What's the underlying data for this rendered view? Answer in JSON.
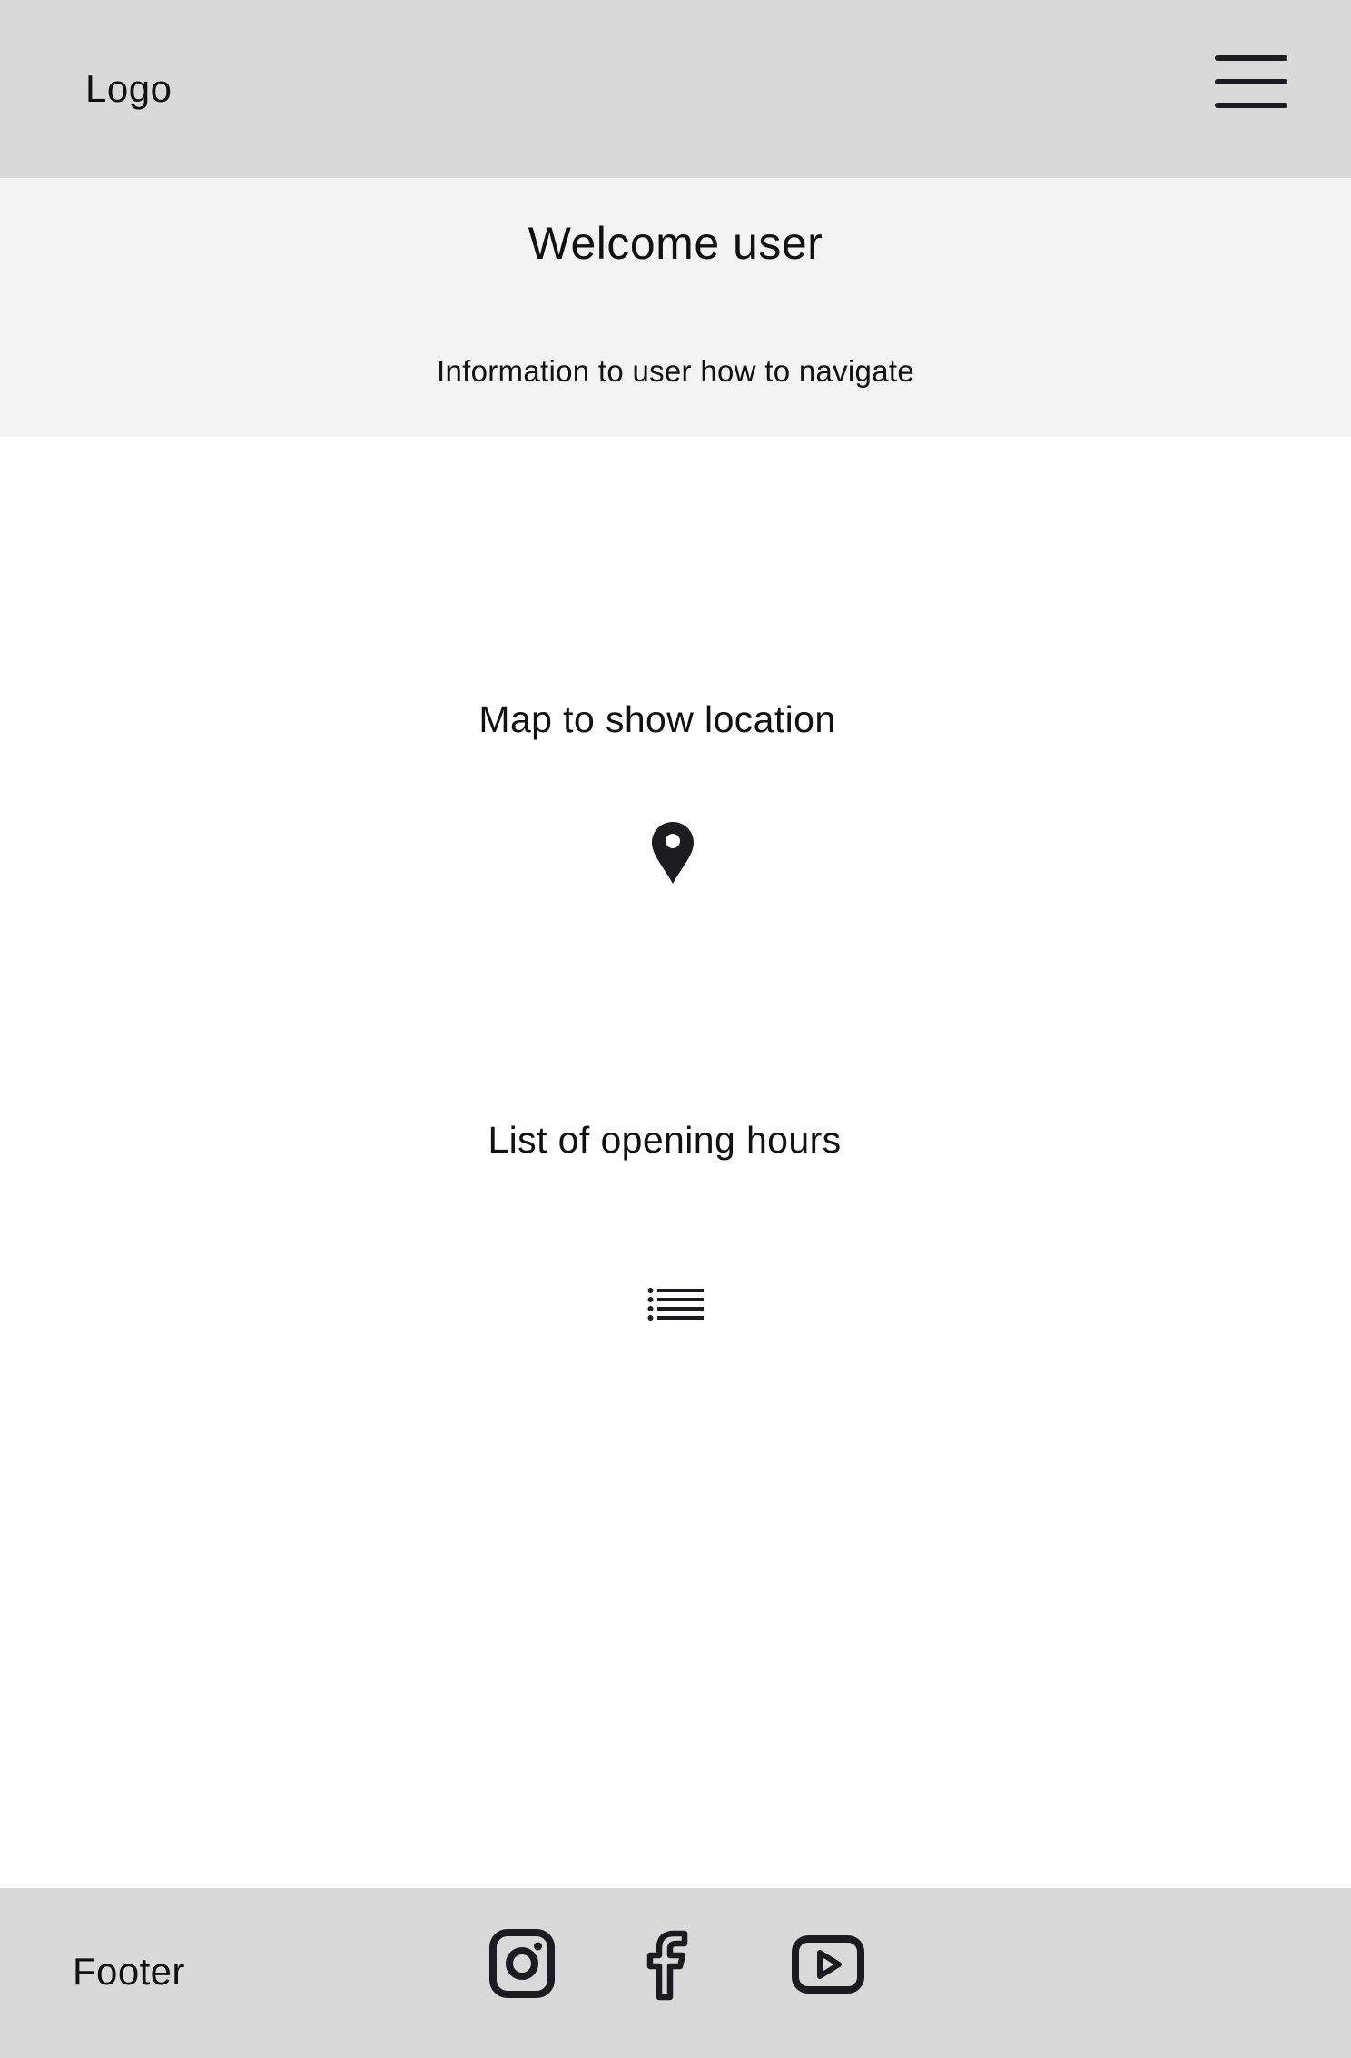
{
  "header": {
    "logo_text": "Logo",
    "menu_icon": "hamburger-menu-icon"
  },
  "welcome": {
    "title": "Welcome user",
    "info": "Information to user how to navigate"
  },
  "main": {
    "map": {
      "label": "Map to show location",
      "icon": "map-pin-icon"
    },
    "opening_hours": {
      "label": "List of opening hours",
      "icon": "list-icon"
    }
  },
  "footer": {
    "label": "Footer",
    "social": [
      {
        "name": "Instagram",
        "icon": "instagram-icon"
      },
      {
        "name": "Facebook",
        "icon": "facebook-icon"
      },
      {
        "name": "YouTube",
        "icon": "youtube-icon"
      }
    ]
  },
  "colors": {
    "header_bg": "#d9d9d9",
    "welcome_bg": "#f3f3f3",
    "main_bg": "#ffffff",
    "footer_bg": "#d9d9d9",
    "icon": "#1c1b1f",
    "text": "#111111"
  }
}
